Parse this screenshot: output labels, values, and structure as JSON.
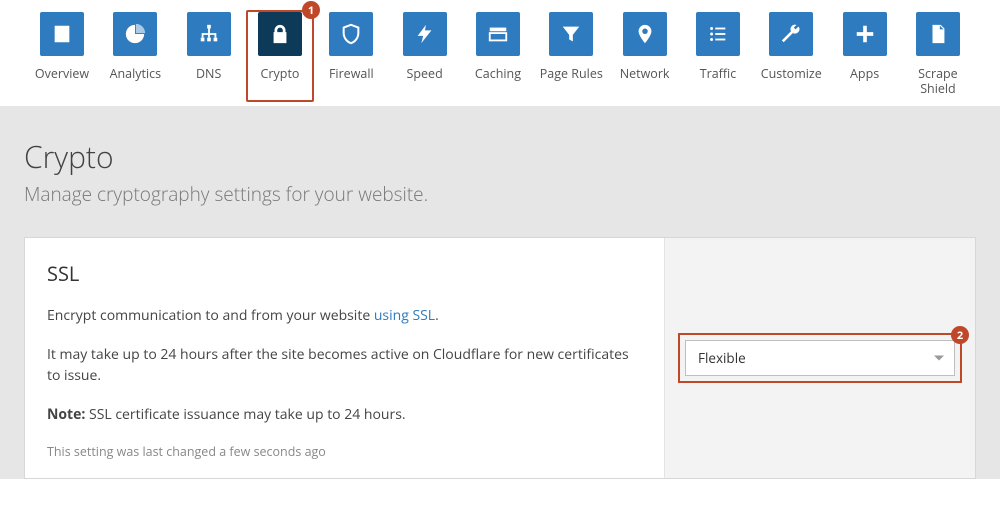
{
  "nav": {
    "activeIndex": 3,
    "items": [
      {
        "label": "Overview",
        "icon": "overview",
        "key": "overview"
      },
      {
        "label": "Analytics",
        "icon": "analytics",
        "key": "analytics"
      },
      {
        "label": "DNS",
        "icon": "dns",
        "key": "dns"
      },
      {
        "label": "Crypto",
        "icon": "crypto",
        "key": "crypto",
        "stepBadge": "1"
      },
      {
        "label": "Firewall",
        "icon": "firewall",
        "key": "firewall"
      },
      {
        "label": "Speed",
        "icon": "speed",
        "key": "speed"
      },
      {
        "label": "Caching",
        "icon": "caching",
        "key": "caching"
      },
      {
        "label": "Page Rules",
        "icon": "pagerules",
        "key": "pagerules"
      },
      {
        "label": "Network",
        "icon": "network",
        "key": "network"
      },
      {
        "label": "Traffic",
        "icon": "traffic",
        "key": "traffic"
      },
      {
        "label": "Customize",
        "icon": "customize",
        "key": "customize"
      },
      {
        "label": "Apps",
        "icon": "apps",
        "key": "apps"
      },
      {
        "label": "Scrape Shield",
        "icon": "scrape",
        "key": "scrape"
      }
    ]
  },
  "header": {
    "title": "Crypto",
    "subtitle": "Manage cryptography settings for your website."
  },
  "ssl": {
    "title": "SSL",
    "desc_prefix": "Encrypt communication to and from your website ",
    "desc_link": "using SSL",
    "desc_suffix": ".",
    "wait": "It may take up to 24 hours after the site becomes active on Cloudflare for new certificates to issue.",
    "note_label": "Note:",
    "note_text": " SSL certificate issuance may take up to 24 hours.",
    "meta": "This setting was last changed a few seconds ago",
    "select_value": "Flexible",
    "select_stepBadge": "2"
  }
}
